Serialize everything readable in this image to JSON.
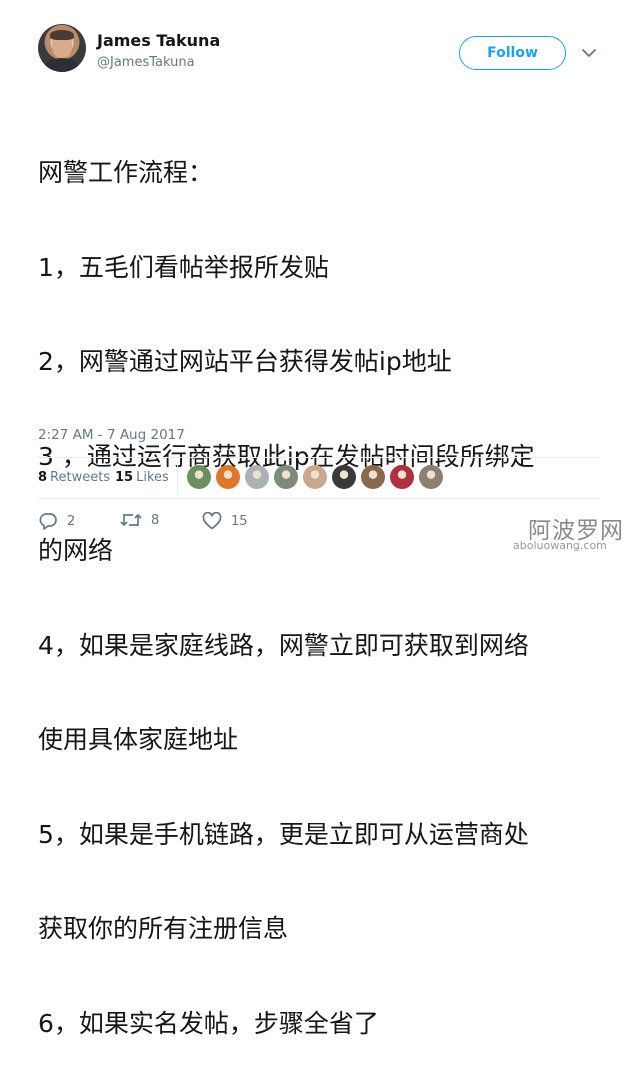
{
  "author": {
    "name": "James Takuna",
    "handle": "@JamesTakuna"
  },
  "follow_label": "Follow",
  "tweet_lines": [
    "网警工作流程：",
    "1，五毛们看帖举报所发贴",
    "2，网警通过网站平台获得发帖ip地址",
    "3 ，通过运行商获取此ip在发帖时间段所绑定",
    "的网络",
    "4，如果是家庭线路，网警立即可获取到网络",
    "使用具体家庭地址",
    "5，如果是手机链路，更是立即可从运营商处",
    "获取你的所有注册信息",
    "6，如果实名发帖，步骤全省了"
  ],
  "timestamp": "2:27 AM - 7 Aug 2017",
  "stats": {
    "retweets_count": "8",
    "retweets_label": "Retweets",
    "likes_count": "15",
    "likes_label": "Likes"
  },
  "liker_avatar_colors": [
    "#6b8f5e",
    "#e0762b",
    "#aab2b8",
    "#7d8c7a",
    "#c9a78c",
    "#3a3a3a",
    "#8a6a4a",
    "#b03040",
    "#8c8070"
  ],
  "actions": {
    "reply_count": "2",
    "retweet_count": "8",
    "like_count": "15"
  },
  "watermark": {
    "main": "阿波罗网",
    "sub": "aboluowang.com"
  },
  "colors": {
    "accent": "#1da1f2",
    "text": "#14171a",
    "muted": "#657786",
    "divider": "#e6ecf0"
  }
}
